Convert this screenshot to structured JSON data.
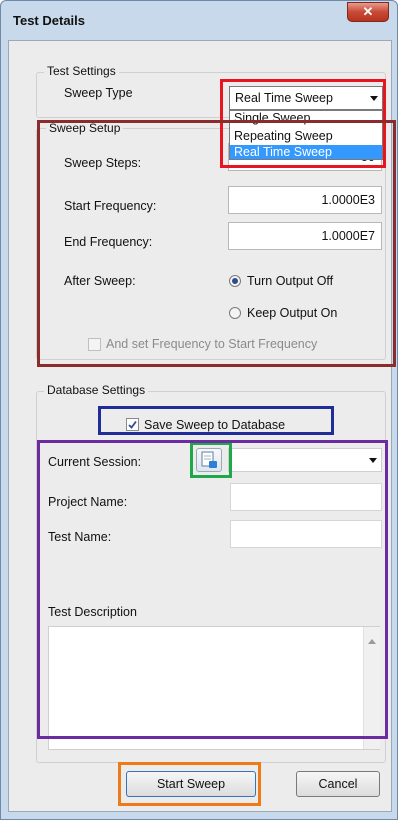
{
  "window": {
    "title": "Test Details",
    "close_glyph": "✕"
  },
  "test_settings": {
    "legend": "Test Settings",
    "sweep_type_label": "Sweep Type",
    "sweep_type_value": "Real Time Sweep",
    "options": [
      "Single Sweep",
      "Repeating Sweep",
      "Real Time Sweep"
    ]
  },
  "sweep_setup": {
    "legend": "Sweep Setup",
    "steps_label": "Sweep Steps:",
    "steps_value": "50",
    "start_label": "Start Frequency:",
    "start_value": "1.0000E3",
    "end_label": "End Frequency:",
    "end_value": "1.0000E7",
    "after_label": "After Sweep:",
    "turn_off_label": "Turn Output Off",
    "keep_on_label": "Keep Output On",
    "set_freq_label": "And set Frequency to Start Frequency"
  },
  "database": {
    "legend": "Database Settings",
    "save_label": "Save Sweep to Database",
    "session_label": "Current Session:",
    "project_label": "Project Name:",
    "test_name_label": "Test Name:",
    "description_label": "Test Description"
  },
  "buttons": {
    "start": "Start Sweep",
    "cancel": "Cancel"
  },
  "colors": {
    "red": "#e8141e",
    "darkred": "#8b2b2b",
    "blue": "#1f2c99",
    "green": "#1ea84a",
    "purple": "#6a2ca0",
    "orange": "#ee7a1a",
    "selection": "#3399ff"
  }
}
